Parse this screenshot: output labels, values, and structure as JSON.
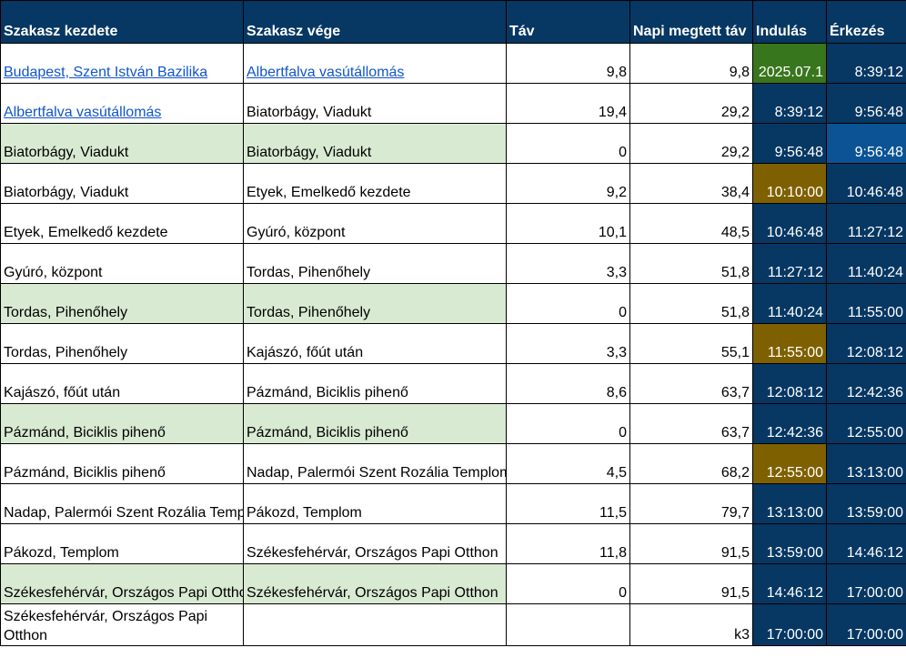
{
  "headers": {
    "start": "Szakasz kezdete",
    "end": "Szakasz vége",
    "dist": "Táv",
    "daily": "Napi megtett táv",
    "dep": "Indulás",
    "arr": "Érkezés"
  },
  "colors": {
    "header_bg": "#073763",
    "rest_row_bg": "#d9ead3",
    "time_blue": "#073763",
    "time_blue_light": "#0b5394",
    "time_gold": "#7f6000",
    "time_green": "#38761d",
    "link": "#1155cc"
  },
  "rows": [
    {
      "start": "Budapest, Szent István Bazilika",
      "start_link": true,
      "end": "Albertfalva vasútállomás",
      "end_link": true,
      "dist": "9,8",
      "daily": "9,8",
      "dep": "2025.07.1",
      "arr": "8:39:12",
      "dep_color": "green",
      "arr_color": "blue",
      "rest": false
    },
    {
      "start": "Albertfalva vasútállomás",
      "start_link": true,
      "end": "Biatorbágy, Viadukt",
      "end_link": false,
      "dist": "19,4",
      "daily": "29,2",
      "dep": "8:39:12",
      "arr": "9:56:48",
      "dep_color": "blue",
      "arr_color": "blue",
      "rest": false
    },
    {
      "start": "Biatorbágy, Viadukt",
      "start_link": false,
      "end": "Biatorbágy, Viadukt",
      "end_link": false,
      "dist": "0",
      "daily": "29,2",
      "dep": "9:56:48",
      "arr": "9:56:48",
      "dep_color": "blue",
      "arr_color": "blue_light",
      "rest": true
    },
    {
      "start": "Biatorbágy, Viadukt",
      "start_link": false,
      "end": "Etyek, Emelkedő kezdete",
      "end_link": false,
      "dist": "9,2",
      "daily": "38,4",
      "dep": "10:10:00",
      "arr": "10:46:48",
      "dep_color": "gold",
      "arr_color": "blue",
      "rest": false
    },
    {
      "start": "Etyek, Emelkedő kezdete",
      "start_link": false,
      "end": "Gyúró, központ",
      "end_link": false,
      "dist": "10,1",
      "daily": "48,5",
      "dep": "10:46:48",
      "arr": "11:27:12",
      "dep_color": "blue",
      "arr_color": "blue",
      "rest": false
    },
    {
      "start": "Gyúró, központ",
      "start_link": false,
      "end": "Tordas, Pihenőhely",
      "end_link": false,
      "dist": "3,3",
      "daily": "51,8",
      "dep": "11:27:12",
      "arr": "11:40:24",
      "dep_color": "blue",
      "arr_color": "blue",
      "rest": false
    },
    {
      "start": "Tordas, Pihenőhely",
      "start_link": false,
      "end": "Tordas, Pihenőhely",
      "end_link": false,
      "dist": "0",
      "daily": "51,8",
      "dep": "11:40:24",
      "arr": "11:55:00",
      "dep_color": "blue",
      "arr_color": "blue",
      "rest": true
    },
    {
      "start": "Tordas, Pihenőhely",
      "start_link": false,
      "end": "Kajászó, főút után",
      "end_link": false,
      "dist": "3,3",
      "daily": "55,1",
      "dep": "11:55:00",
      "arr": "12:08:12",
      "dep_color": "gold",
      "arr_color": "blue",
      "rest": false
    },
    {
      "start": "Kajászó, főút után",
      "start_link": false,
      "end": "Pázmánd, Biciklis pihenő",
      "end_link": false,
      "dist": "8,6",
      "daily": "63,7",
      "dep": "12:08:12",
      "arr": "12:42:36",
      "dep_color": "blue",
      "arr_color": "blue",
      "rest": false
    },
    {
      "start": "Pázmánd, Biciklis pihenő",
      "start_link": false,
      "end": "Pázmánd, Biciklis pihenő",
      "end_link": false,
      "dist": "0",
      "daily": "63,7",
      "dep": "12:42:36",
      "arr": "12:55:00",
      "dep_color": "blue",
      "arr_color": "blue",
      "rest": true
    },
    {
      "start": "Pázmánd, Biciklis pihenő",
      "start_link": false,
      "end": "Nadap, Palermói Szent Rozália Templom",
      "end_link": false,
      "dist": "4,5",
      "daily": "68,2",
      "dep": "12:55:00",
      "arr": "13:13:00",
      "dep_color": "gold",
      "arr_color": "blue",
      "rest": false
    },
    {
      "start": "Nadap, Palermói Szent Rozália Templom",
      "start_link": false,
      "end": "Pákozd, Templom",
      "end_link": false,
      "dist": "11,5",
      "daily": "79,7",
      "dep": "13:13:00",
      "arr": "13:59:00",
      "dep_color": "blue",
      "arr_color": "blue",
      "rest": false
    },
    {
      "start": "Pákozd, Templom",
      "start_link": false,
      "end": "Székesfehérvár, Országos Papi Otthon",
      "end_link": false,
      "dist": "11,8",
      "daily": "91,5",
      "dep": "13:59:00",
      "arr": "14:46:12",
      "dep_color": "blue",
      "arr_color": "blue",
      "rest": false
    },
    {
      "start": "Székesfehérvár, Országos Papi Otthon",
      "start_link": false,
      "end": "Székesfehérvár, Országos Papi Otthon",
      "end_link": false,
      "dist": "0",
      "daily": "91,5",
      "dep": "14:46:12",
      "arr": "17:00:00",
      "dep_color": "blue",
      "arr_color": "blue",
      "rest": true
    },
    {
      "start": "Székesfehérvár, Országos Papi Otthon",
      "start_link": false,
      "end": "",
      "end_link": false,
      "dist": "",
      "daily": "k3",
      "dep": "17:00:00",
      "arr": "17:00:00",
      "dep_color": "blue",
      "arr_color": "blue",
      "rest": false,
      "wrap_start": true
    }
  ]
}
